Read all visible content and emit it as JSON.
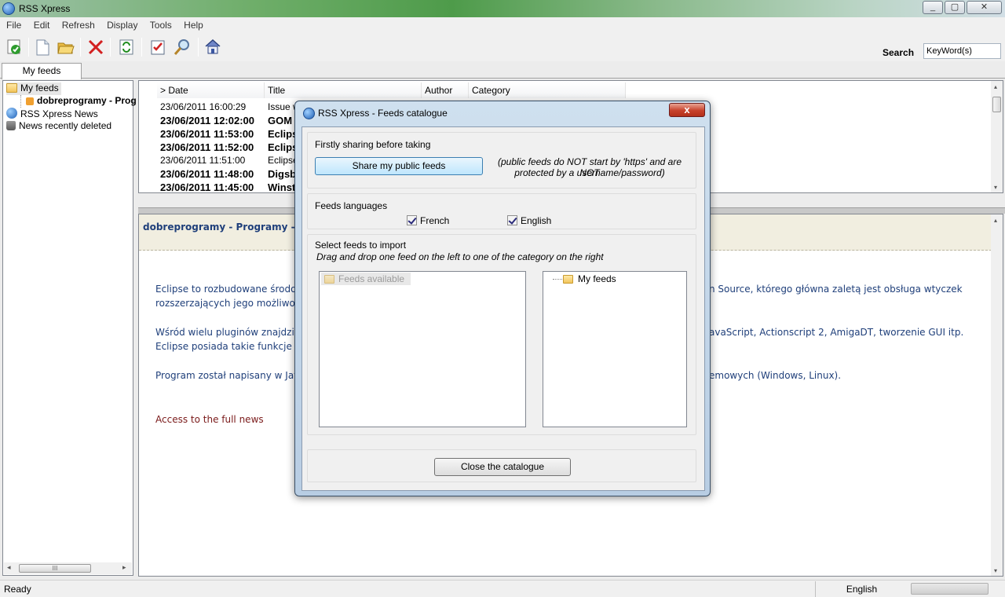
{
  "window": {
    "title": "RSS Xpress",
    "buttons": [
      "minimize",
      "maximize",
      "close"
    ]
  },
  "menu": [
    "File",
    "Edit",
    "Refresh",
    "Display",
    "Tools",
    "Help"
  ],
  "toolbar": {
    "buttons": [
      "mark-read-icon",
      "new-feed-icon",
      "open-folder-icon",
      "delete-icon",
      "refresh-icon",
      "tasks-icon",
      "find-icon",
      "home-icon"
    ],
    "search_label": "Search",
    "search_value": "KeyWord(s)"
  },
  "tabs": {
    "active": "My feeds"
  },
  "tree": {
    "items": [
      {
        "label": "My feeds",
        "icon": "folder-icon"
      },
      {
        "label": "dobreprogramy - Prog",
        "icon": "feed-icon"
      },
      {
        "label": "RSS Xpress News",
        "icon": "rss-xpress-icon"
      },
      {
        "label": "News recently deleted",
        "icon": "trash-icon"
      }
    ],
    "hscroll_thumb": "III"
  },
  "newslist": {
    "columns": [
      "> Date",
      "Title",
      "Author",
      "Category"
    ],
    "rows": [
      {
        "date": "23/06/2011 16:00:29",
        "title": "Issue w",
        "bold": false
      },
      {
        "date": "23/06/2011 12:02:00",
        "title": "GOM",
        "bold": true
      },
      {
        "date": "23/06/2011 11:53:00",
        "title": "Eclips",
        "bold": true
      },
      {
        "date": "23/06/2011 11:52:00",
        "title": "Eclips",
        "bold": true
      },
      {
        "date": "23/06/2011 11:51:00",
        "title": "Eclipse",
        "bold": false
      },
      {
        "date": "23/06/2011 11:48:00",
        "title": "Digsb",
        "bold": true
      },
      {
        "date": "23/06/2011 11:45:00",
        "title": "Winst",
        "bold": true
      }
    ]
  },
  "preview": {
    "title": "dobreprogramy - Programy - wersj",
    "paragraphs": [
      "Eclipse to rozbudowane środov",
      "rozszerzających jego możliwoś",
      "Wśród wielu pluginów znajdzie",
      "Eclipse posiada takie funkcje j",
      "Program został napisany w Jav"
    ],
    "paragraphs_right": [
      "n Source, którego główna zaletą jest obsługa wtyczek",
      "avaScript, Actionscript 2, AmigaDT, tworzenie GUI itp.",
      "emowych (Windows, Linux)."
    ],
    "link": "Access to the full news"
  },
  "status": {
    "text": "Ready",
    "language": "English"
  },
  "dialog": {
    "title": "RSS Xpress - Feeds catalogue",
    "close_label": "x",
    "sharing": {
      "title": "Firstly sharing before taking",
      "button": "Share my public feeds",
      "note_line1": "(public feeds do NOT start by 'https' and are NOT",
      "note_line2": "protected by a username/password)"
    },
    "languages": {
      "title": "Feeds languages",
      "options": [
        {
          "label": "French",
          "checked": true
        },
        {
          "label": "English",
          "checked": true
        }
      ]
    },
    "import": {
      "title": "Select feeds to import",
      "hint": "Drag and drop one feed on the left to one of the category on the right",
      "left_root": "Feeds available",
      "right_root": "My feeds"
    },
    "close_button": "Close the catalogue"
  }
}
